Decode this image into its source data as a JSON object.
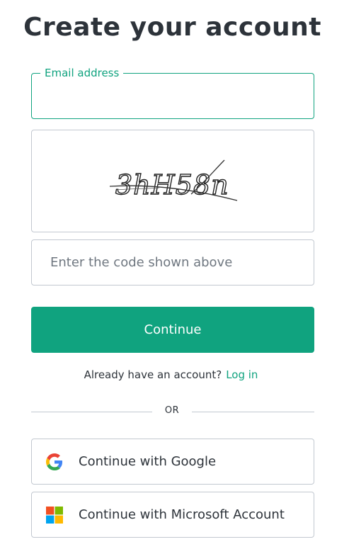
{
  "page": {
    "title": "Create your account"
  },
  "email": {
    "label": "Email address",
    "value": ""
  },
  "captcha": {
    "text": "3hH58n"
  },
  "code": {
    "placeholder": "Enter the code shown above",
    "value": ""
  },
  "actions": {
    "continue_label": "Continue"
  },
  "login": {
    "prompt": "Already have an account?",
    "link_label": "Log in"
  },
  "divider": {
    "text": "OR"
  },
  "social": {
    "google_label": "Continue with Google",
    "google_icon": "google-icon",
    "microsoft_label": "Continue with Microsoft Account",
    "microsoft_icon": "microsoft-icon"
  },
  "colors": {
    "accent": "#10a37f",
    "text": "#2d333a",
    "border": "#c2c8d0"
  }
}
